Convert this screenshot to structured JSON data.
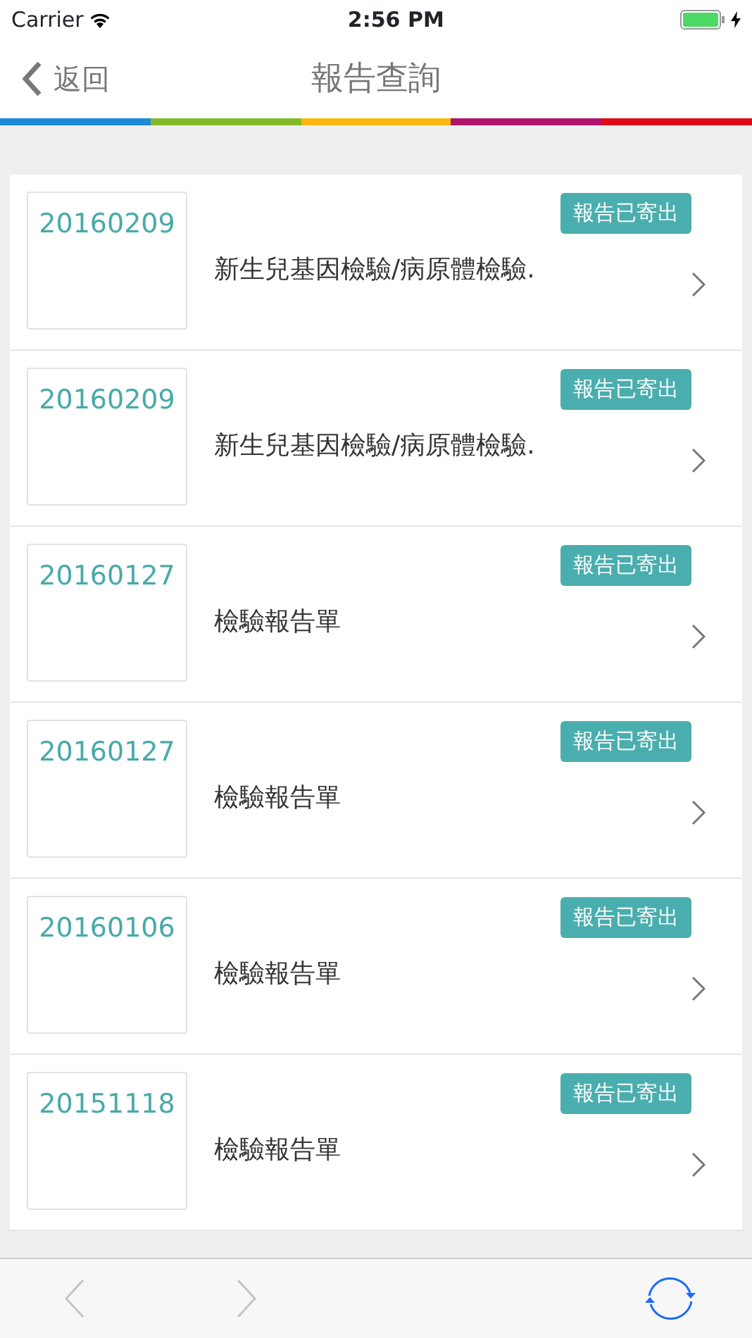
{
  "status_bar": {
    "carrier": "Carrier",
    "time": "2:56 PM",
    "charging": true
  },
  "nav_bar": {
    "back": "返回",
    "title": "報告查詢"
  },
  "reports": [
    {
      "date": "20160209",
      "status": "報告已寄出",
      "title": "新生兒基因檢驗/病原體檢驗."
    },
    {
      "date": "20160209",
      "status": "報告已寄出",
      "title": "新生兒基因檢驗/病原體檢驗."
    },
    {
      "date": "20160127",
      "status": "報告已寄出",
      "title": "檢驗報告單"
    },
    {
      "date": "20160127",
      "status": "報告已寄出",
      "title": "檢驗報告單"
    },
    {
      "date": "20160106",
      "status": "報告已寄出",
      "title": "檢驗報告單"
    },
    {
      "date": "20151118",
      "status": "報告已寄出",
      "title": "檢驗報告單"
    }
  ],
  "toolbar": {
    "back_disabled": true,
    "forward_disabled": true
  }
}
